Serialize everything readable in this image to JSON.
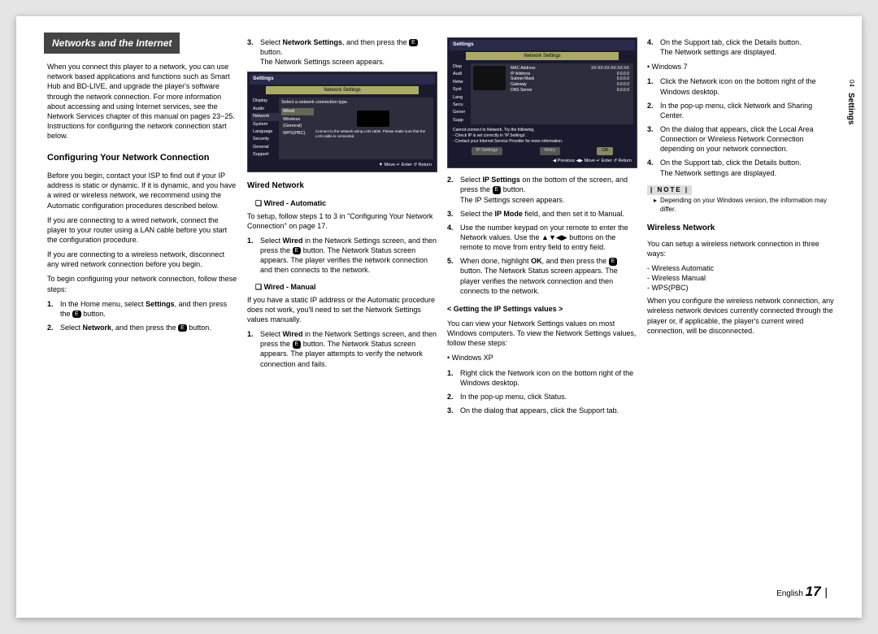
{
  "header": {
    "title": "Networks and the Internet"
  },
  "sideTab": {
    "num": "04",
    "label": "Settings"
  },
  "footer": {
    "lang": "English",
    "page": "17"
  },
  "col1": {
    "intro": "When you connect this player to a network, you can use network based applications and functions such as Smart Hub and BD-LIVE, and upgrade the player's software through the network connection. For more information about accessing and using Internet services, see the Network Services chapter of this manual on pages 23~25. Instructions for configuring the network connection start below.",
    "h1": "Configuring Your Network Connection",
    "p1": "Before you begin, contact your ISP to find out if your IP address is static or dynamic. If it is dynamic, and you have a wired or wireless network, we recommend using the Automatic configuration procedures described below.",
    "p2": "If you are connecting to a wired network, connect the player to your router using a LAN cable before you start the configuration procedure.",
    "p3": "If you are connecting to a wireless network, disconnect any wired network connection before you begin.",
    "p4": "To begin configuring your network connection, follow these steps:",
    "s1n": "1.",
    "s1t1": "In the Home menu, select ",
    "s1b": "Settings",
    "s1t2": ", and then press the ",
    "s1t3": " button.",
    "s2n": "2.",
    "s2t1": "Select ",
    "s2b": "Network",
    "s2t2": ", and then press the ",
    "s2t3": " button."
  },
  "col2": {
    "s3n": "3.",
    "s3t1": "Select ",
    "s3b": "Network Settings",
    "s3t2": ", and then press the ",
    "s3t3": " button.",
    "s3t4": "The Network Settings screen appears.",
    "scr1": {
      "title": "Settings",
      "hdr": "Network Settings",
      "side": [
        "Display",
        "Audio",
        "Network",
        "System",
        "Language",
        "Security",
        "General",
        "Support"
      ],
      "prompt": "Select a network connection type.",
      "opts": [
        "Wired",
        "Wireless (General)",
        "WPS(PBC)"
      ],
      "hint": "Connect to the network using LAN cable. Please make sure that the LAN cable is connected.",
      "bottom": "▼ Move   ↵ Enter   ↺ Return"
    },
    "h1": "Wired Network",
    "h2": "❏ Wired - Automatic",
    "p1": "To setup, follow steps 1 to 3 in \"Configuring Your Network Connection\" on page 17.",
    "s1n": "1.",
    "s1t1": "Select ",
    "s1b": "Wired",
    "s1t2": " in the Network Settings screen, and then press the ",
    "s1t3": " button. The Network Status screen appears. The player verifies the network connection and then connects to the network.",
    "h3": "❏ Wired - Manual",
    "p2": "If you have a static IP address or the Automatic procedure does not work, you'll need to set the Network Settings values manually.",
    "s2n": "1.",
    "s2t1": "Select ",
    "s2b": "Wired",
    "s2t2": " in the Network Settings screen, and then press the ",
    "s2t3": " button. The Network Status screen appears. The player attempts to verify the network connection and fails."
  },
  "col3": {
    "scr2": {
      "title": "Settings",
      "hdr": "Network Settings",
      "side": [
        "Disp",
        "Audi",
        "Netw",
        "Syst",
        "Lang",
        "Secu",
        "Gener",
        "Supp"
      ],
      "rows": [
        {
          "k": "MAC Address",
          "v": "XX:XX:XX:XX:XX:XX"
        },
        {
          "k": "IP Address",
          "v": "0.0.0.0"
        },
        {
          "k": "Subnet Mask",
          "v": "0.0.0.0"
        },
        {
          "k": "Gateway",
          "v": "0.0.0.0"
        },
        {
          "k": "DNS Server",
          "v": "0.0.0.0"
        }
      ],
      "msg1": "Cannot connect to Network. Try the following.",
      "msg2": "- Check IP is set correctly in 'IP Settings'.",
      "msg3": "- Contact your Internet Service Provider for more information.",
      "btns": [
        "IP Settings",
        "Retry",
        "OK"
      ],
      "bottom": "◀ Previous   ◀▶ Move   ↵ Enter   ↺ Return"
    },
    "s2n": "2.",
    "s2t1": "Select ",
    "s2b": "IP Settings",
    "s2t2": " on the bottom of the screen, and press the ",
    "s2t3": " button.",
    "s2t4": "The IP Settings screen appears.",
    "s3n": "3.",
    "s3t1": "Select the ",
    "s3b": "IP Mode",
    "s3t2": " field, and then set it to Manual.",
    "s4n": "4.",
    "s4t": "Use the number keypad on your remote to enter the Network values. Use the ▲▼◀▶ buttons on the remote to move from entry field to entry field.",
    "s5n": "5.",
    "s5t1": "When done, highlight ",
    "s5b": "OK",
    "s5t2": ", and then press the ",
    "s5t3": " button. The Network Status screen appears. The player verifies the network connection and then connects to the network.",
    "h1": "< Getting the IP Settings values >",
    "p1": "You can view your Network Settings values on most Windows computers. To view the Network Settings values, follow these steps:",
    "b1": "Windows XP",
    "w1n": "1.",
    "w1t": "Right click the Network icon on the bottom right of the Windows desktop.",
    "w2n": "2.",
    "w2t": "In the pop-up menu, click Status.",
    "w3n": "3.",
    "w3t": "On the dialog that appears, click the Support tab."
  },
  "col4": {
    "s4n": "4.",
    "s4t": "On the Support tab, click the Details button.",
    "s4t2": "The Network settings are displayed.",
    "b1": "Windows 7",
    "w1n": "1.",
    "w1t": "Click the Network icon on the bottom right of the Windows desktop.",
    "w2n": "2.",
    "w2t": "In the pop-up menu, click Network and Sharing Center.",
    "w3n": "3.",
    "w3t": "On the dialog that appears, click the Local Area Connection or Wireless Network Connection depending on your network connection.",
    "w4n": "4.",
    "w4t": "On the Support tab, click the Details button.",
    "w4t2": "The Network settings are displayed.",
    "noteLbl": "| NOTE |",
    "noteTxt": "Depending on your Windows version, the information may differ.",
    "h1": "Wireless Network",
    "p1": "You can setup a wireless network connection in three ways:",
    "opts": [
      "Wireless Automatic",
      "Wireless Manual",
      "WPS(PBC)"
    ],
    "p2": "When you configure the wireless network connection, any wireless network devices currently connected through the player or, if applicable, the player's current wired connection, will be disconnected."
  }
}
